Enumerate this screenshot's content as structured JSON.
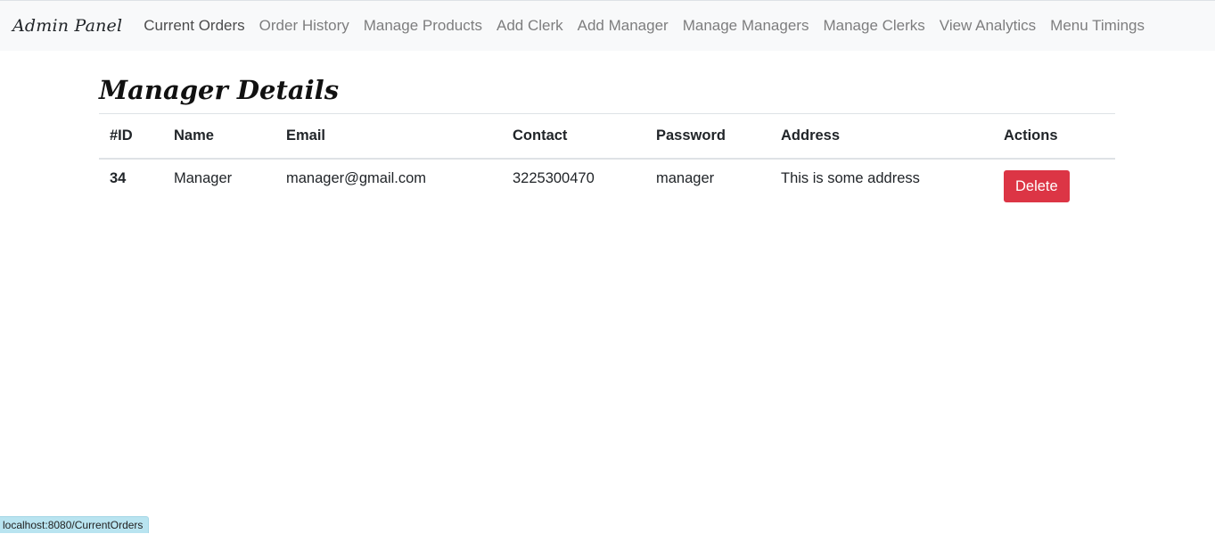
{
  "navbar": {
    "brand": "Admin Panel",
    "links": [
      {
        "label": "Current Orders",
        "active": true
      },
      {
        "label": "Order History"
      },
      {
        "label": "Manage Products"
      },
      {
        "label": "Add Clerk"
      },
      {
        "label": "Add Manager"
      },
      {
        "label": "Manage Managers"
      },
      {
        "label": "Manage Clerks"
      },
      {
        "label": "View Analytics"
      },
      {
        "label": "Menu Timings"
      }
    ]
  },
  "main": {
    "title": "Manager Details",
    "table": {
      "columns": [
        "#ID",
        "Name",
        "Email",
        "Contact",
        "Password",
        "Address",
        "Actions"
      ],
      "rows": [
        {
          "id": "34",
          "name": "Manager",
          "email": "manager@gmail.com",
          "contact": "3225300470",
          "password": "manager",
          "address": "This is some address",
          "action_label": "Delete"
        }
      ]
    }
  },
  "status_bar": {
    "url": "localhost:8080/CurrentOrders"
  },
  "colors": {
    "navbar_bg": "#f8f9fa",
    "danger": "#dc3545",
    "status_bg": "#b9e4f0"
  }
}
